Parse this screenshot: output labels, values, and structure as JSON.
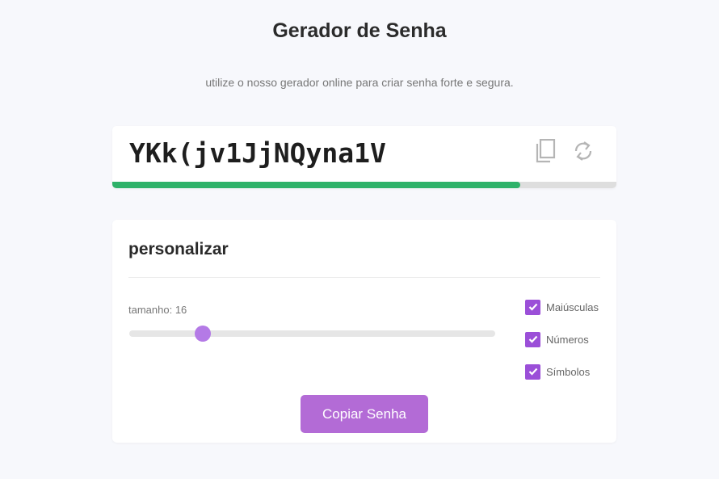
{
  "header": {
    "title": "Gerador de Senha",
    "subtitle": "utilize o nosso gerador online para criar senha forte e segura."
  },
  "password": {
    "value": "YKk(jv1JjNQyna1V",
    "copy_icon": "copy-icon",
    "refresh_icon": "refresh-icon",
    "strength_fraction": 0.81,
    "strength_color": "#2fb26a"
  },
  "customize": {
    "title": "personalizar",
    "length_label": "tamanho: 16",
    "length_value": 16,
    "length_min": 4,
    "length_max": 64,
    "options": [
      {
        "label": "Maiúsculas",
        "checked": true
      },
      {
        "label": "Números",
        "checked": true
      },
      {
        "label": "Símbolos",
        "checked": true
      }
    ],
    "copy_button_label": "Copiar Senha",
    "accent_color": "#9b4fd8",
    "button_color": "#b36bd6"
  }
}
